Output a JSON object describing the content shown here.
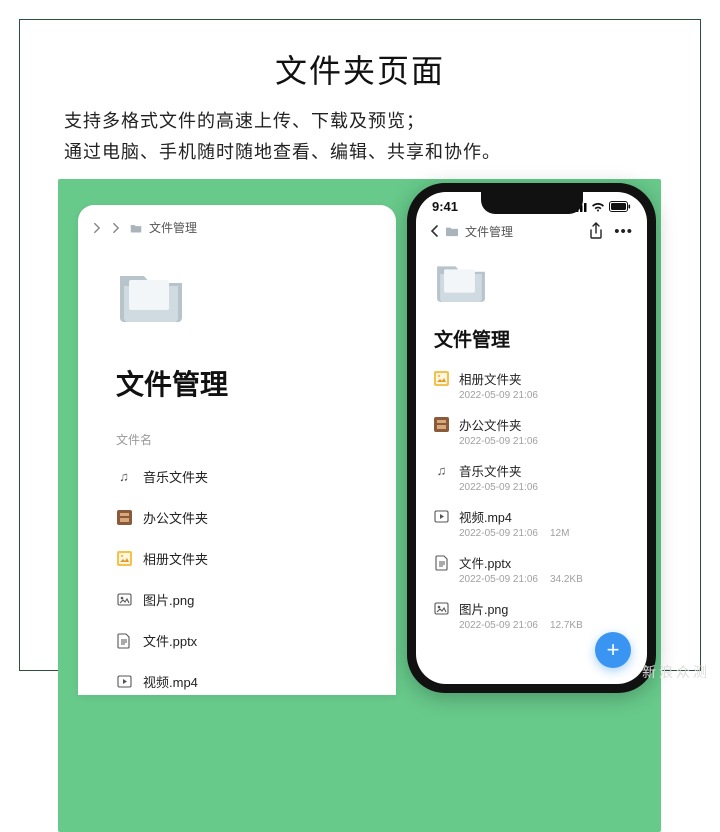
{
  "header": {
    "title": "文件夹页面",
    "line1": "支持多格式文件的高速上传、下载及预览；",
    "line2": "通过电脑、手机随时随地查看、编辑、共享和协作。"
  },
  "desktop": {
    "breadcrumb": "文件管理",
    "heading": "文件管理",
    "column": "文件名",
    "rows": [
      {
        "icon": "music",
        "name": "音乐文件夹"
      },
      {
        "icon": "office",
        "name": "办公文件夹"
      },
      {
        "icon": "photos",
        "name": "相册文件夹"
      },
      {
        "icon": "image",
        "name": "图片.png"
      },
      {
        "icon": "file",
        "name": "文件.pptx"
      },
      {
        "icon": "video",
        "name": "视频.mp4"
      }
    ]
  },
  "phone": {
    "time": "9:41",
    "breadcrumb": "文件管理",
    "heading": "文件管理",
    "rows": [
      {
        "icon": "photos",
        "name": "相册文件夹",
        "meta": "2022-05-09 21:06"
      },
      {
        "icon": "office",
        "name": "办公文件夹",
        "meta": "2022-05-09 21:06"
      },
      {
        "icon": "music",
        "name": "音乐文件夹",
        "meta": "2022-05-09 21:06"
      },
      {
        "icon": "video",
        "name": "视频.mp4",
        "meta": "2022-05-09 21:06",
        "size": "12M"
      },
      {
        "icon": "file",
        "name": "文件.pptx",
        "meta": "2022-05-09 21:06",
        "size": "34.2KB"
      },
      {
        "icon": "image",
        "name": "图片.png",
        "meta": "2022-05-09 21:06",
        "size": "12.7KB"
      }
    ]
  },
  "watermark": "新浪众测",
  "icons": {
    "music": "♪",
    "video": "▶",
    "file": "▤",
    "image": "◉"
  }
}
